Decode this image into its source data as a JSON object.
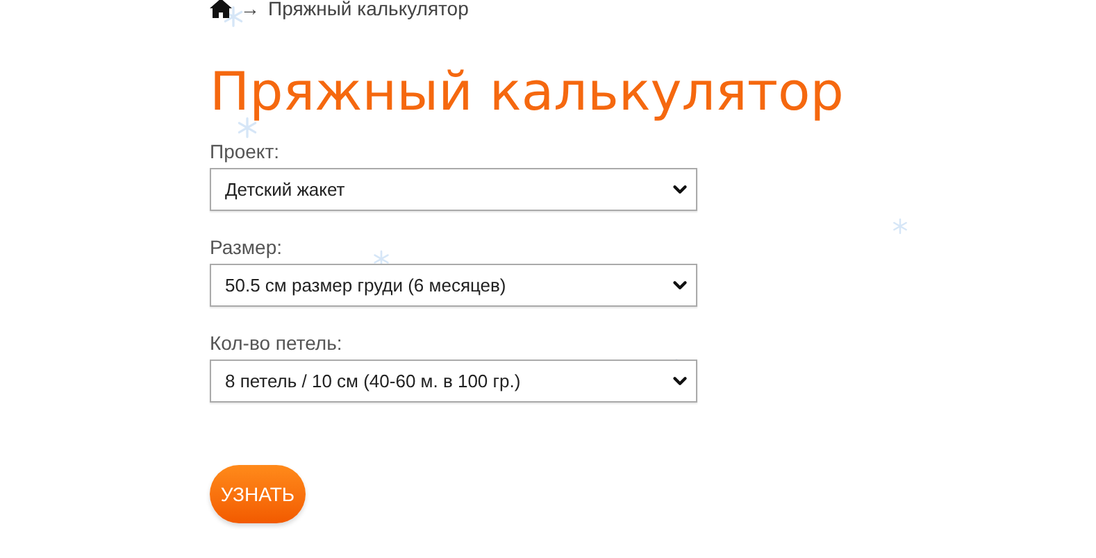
{
  "breadcrumb": {
    "separator": "→",
    "current": "Пряжный калькулятор"
  },
  "title": "Пряжный калькулятор",
  "fields": [
    {
      "label": "Проект:",
      "value": "Детский жакет"
    },
    {
      "label": "Размер:",
      "value": "50.5 см размер груди (6 месяцев)"
    },
    {
      "label": "Кол-во петель:",
      "value": "8 петель / 10 см (40-60 м. в 100 гр.)"
    }
  ],
  "submit_button": "УЗНАТЬ"
}
